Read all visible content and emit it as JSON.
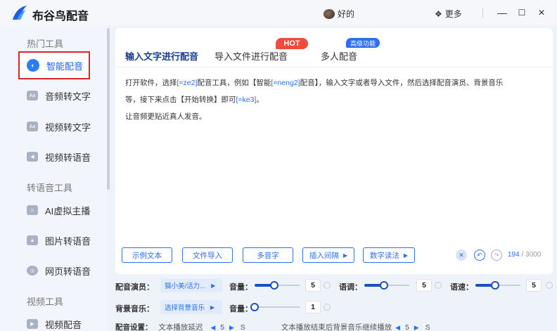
{
  "app": {
    "title": "布谷鸟配音"
  },
  "header": {
    "user_name": "好的",
    "more_label": "更多",
    "minimize": "—",
    "maximize": "☐",
    "close": "✕"
  },
  "sidebar": {
    "sections": [
      {
        "title": "热门工具"
      },
      {
        "title": "转语音工具"
      },
      {
        "title": "视频工具"
      }
    ],
    "items": [
      {
        "label": "智能配音",
        "icon": "smart-dub-icon",
        "active": true
      },
      {
        "label": "音频转文字",
        "icon": "audio-text-icon"
      },
      {
        "label": "视频转文字",
        "icon": "video-text-icon"
      },
      {
        "label": "视频转语音",
        "icon": "video-voice-icon"
      },
      {
        "label": "AI虚拟主播",
        "icon": "ai-anchor-icon"
      },
      {
        "label": "图片转语音",
        "icon": "image-voice-icon"
      },
      {
        "label": "网页转语音",
        "icon": "web-voice-icon"
      },
      {
        "label": "视频配音",
        "icon": "video-dub-icon"
      }
    ]
  },
  "tabs": [
    {
      "label": "输入文字进行配音",
      "active": true
    },
    {
      "label": "导入文件进行配音",
      "badge": "HOT"
    },
    {
      "label": "多人配音",
      "badge": "高级功能"
    }
  ],
  "editor": {
    "line1_a": "打开软件，选择",
    "line1_b": "[=ze2]",
    "line1_c": "配音工具，例如【智能",
    "line1_d": "[=neng2]",
    "line1_e": "配音】，输入文字或者导入文件，然后选择配音演员、背景音乐",
    "line2_a": "等，接下来点击【开始转换】即可",
    "line2_b": "[=ke3]",
    "line2_c": "。",
    "line3": "让音频更贴近真人发音。"
  },
  "toolbar": {
    "example": "示例文本",
    "import": "文件导入",
    "polyphone": "多音字",
    "pause": "插入间隔",
    "number": "数字读法",
    "count": "194",
    "max": "/ 3000"
  },
  "settings": {
    "voice_label": "配音演员：",
    "voice_value": "猫小美/活力...",
    "volume_label": "音量：",
    "volume_value": "5",
    "tone_label": "语调：",
    "tone_value": "5",
    "speed_label": "语速：",
    "speed_value": "5",
    "bg_label": "背景音乐：",
    "bg_value": "选择背景音乐",
    "bg_volume_label": "音量：",
    "bg_volume_value": "1",
    "cfg_label": "配音设置：",
    "cfg_delay": "文本播放延迟",
    "cfg_delay_value": "5",
    "cfg_unit": "S",
    "cfg_after": "文本播放结束后背景音乐继续播放",
    "cfg_after_value": "5",
    "cfg_after_unit": "S"
  },
  "colors": {
    "accent": "#2b6ff0",
    "hot": "#f04a3a",
    "highlight_box": "#d8262b"
  }
}
